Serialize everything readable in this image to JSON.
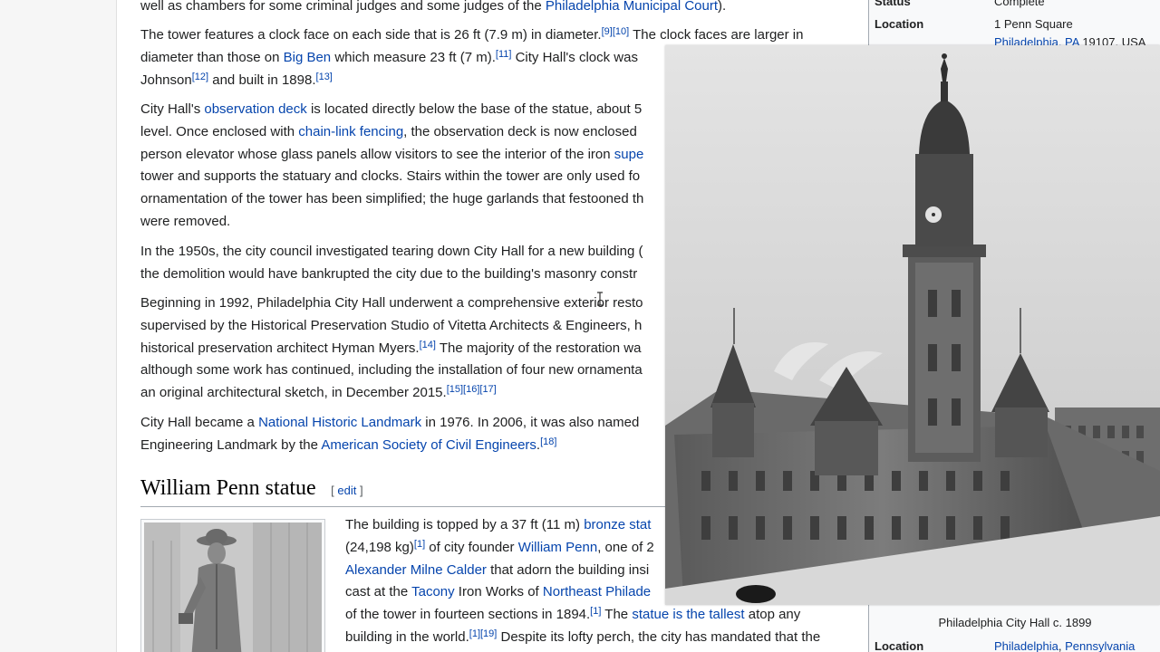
{
  "article": {
    "p0": {
      "text": "well as chambers for some criminal judges and some judges of the ",
      "link": "Philadelphia Municipal Court",
      "after": ")."
    },
    "p1": {
      "l1_a": "The tower features a clock face on each side that is 26 ft (7.9 m) in diameter.",
      "l1_sup": "[9][10]",
      "l1_b": " The clock faces are larger in",
      "l2_a": "diameter than those on ",
      "l2_link": "Big Ben",
      "l2_b": " which measure 23 ft (7 m).",
      "l2_sup": "[11]",
      "l2_c": " City Hall's clock was",
      "l3_a": "Johnson",
      "l3_sup1": "[12]",
      "l3_b": " and built in 1898.",
      "l3_sup2": "[13]"
    },
    "p2": {
      "l1_a": "City Hall's ",
      "l1_link": "observation deck",
      "l1_b": " is located directly below the base of the statue, about 5",
      "l2_a": "level. Once enclosed with ",
      "l2_link": "chain-link fencing",
      "l2_b": ", the observation deck is now enclosed",
      "l3_a": "person elevator whose glass panels allow visitors to see the interior of the iron ",
      "l3_link": "supe",
      "l4": "tower and supports the statuary and clocks. Stairs within the tower are only used fo",
      "l5": "ornamentation of the tower has been simplified; the huge garlands that festooned th",
      "l6": "were removed."
    },
    "p3": {
      "l1": "In the 1950s, the city council investigated tearing down City Hall for a new building (",
      "l2": "the demolition would have bankrupted the city due to the building's masonry constr"
    },
    "p4": {
      "l1": "Beginning in 1992, Philadelphia City Hall underwent a comprehensive exterior resto",
      "l2": "supervised by the Historical Preservation Studio of Vitetta Architects & Engineers, h",
      "l3_a": "historical preservation architect Hyman Myers.",
      "l3_sup": "[14]",
      "l3_b": " The majority of the restoration wa",
      "l4": "although some work has continued, including the installation of four new ornamenta",
      "l5_a": "an original architectural sketch, in December 2015.",
      "l5_sup": "[15][16][17]"
    },
    "p5": {
      "l1_a": "City Hall became a ",
      "l1_link": "National Historic Landmark",
      "l1_b": " in 1976. In 2006, it was also named",
      "l2_a": "Engineering Landmark by the ",
      "l2_link": "American Society of Civil Engineers",
      "l2_b": ".",
      "l2_sup": "[18]"
    },
    "section": {
      "title": "William Penn statue",
      "edit_open": "[ ",
      "edit_label": "edit",
      "edit_close": " ]"
    },
    "p6": {
      "l1_a": "The building is topped by a 37 ft (11 m) ",
      "l1_link": "bronze stat",
      "l2_a": "(24,198 kg)",
      "l2_sup": "[1]",
      "l2_b": " of city founder ",
      "l2_link": "William Penn",
      "l2_c": ", one of 2",
      "l3_link": "Alexander Milne Calder",
      "l3_b": " that adorn the building insi",
      "l4_a": "cast at the ",
      "l4_link1": "Tacony",
      "l4_b": " Iron Works of ",
      "l4_link2": "Northeast Philade",
      "l5_a": "of the tower in fourteen sections in 1894.",
      "l5_sup": "[1]",
      "l5_b": " The ",
      "l5_link": "statue is the tallest",
      "l5_c": " atop any",
      "l6_a": "building in the world.",
      "l6_sup": "[1][19]",
      "l6_b": " Despite its lofty perch, the city has mandated that the"
    }
  },
  "infobox": {
    "status_label": "Status",
    "status_value": "Complete",
    "location_label": "Location",
    "location_value_1": "1 Penn Square",
    "location_value_2_link": "Philadelphia, PA",
    "location_value_2_rest": " 19107, USA",
    "caption": "Philadelphia City Hall c. 1899",
    "location2_label": "Location",
    "location2_link1": "Philadelphia",
    "location2_sep": ", ",
    "location2_link2": "Pennsylvania"
  },
  "colors": {
    "link": "#0645ad",
    "text": "#202122",
    "infobox_bg": "#f8f9fa"
  },
  "icons": {
    "cursor": "text-cursor-icon"
  }
}
